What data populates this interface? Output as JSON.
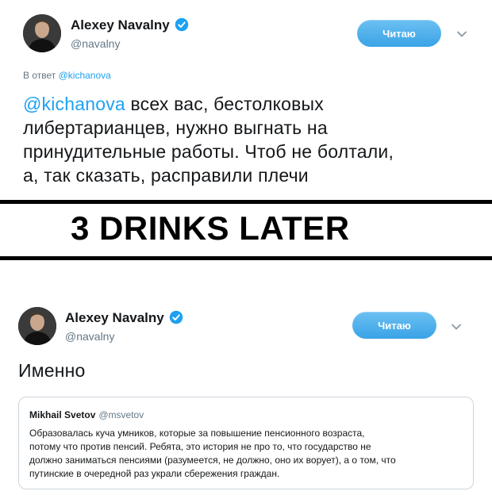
{
  "tweet1": {
    "author": {
      "name": "Alexey Navalny",
      "handle": "@navalny"
    },
    "follow_label": "Читаю",
    "reply_prefix": "В ответ",
    "reply_handle": "@kichanova",
    "mention": "@kichanova",
    "text_lines": [
      " всех вас, бестолковых",
      "либертарианцев, нужно выгнать на",
      "принудительные работы. Чтоб не болтали,",
      "а, так сказать, расправили плечи"
    ]
  },
  "banner": {
    "text": "3 DRINKS LATER"
  },
  "tweet2": {
    "author": {
      "name": "Alexey Navalny",
      "handle": "@navalny"
    },
    "follow_label": "Читаю",
    "text": "Именно",
    "quote": {
      "name": "Mikhail Svetov",
      "handle": "@msvetov",
      "lines": [
        "Образовалась куча умников, которые за повышение пенсионного возраста,",
        "потому что против пенсий. Ребята, это история не про то, что государство не",
        "должно заниматься пенсиями (разумеется, не должно, оно их ворует), а о том, что",
        "путинские в очередной раз украли сбережения граждан."
      ]
    }
  },
  "colors": {
    "twitter_blue": "#1da1f2",
    "band": "#000000",
    "muted": "#657786"
  }
}
